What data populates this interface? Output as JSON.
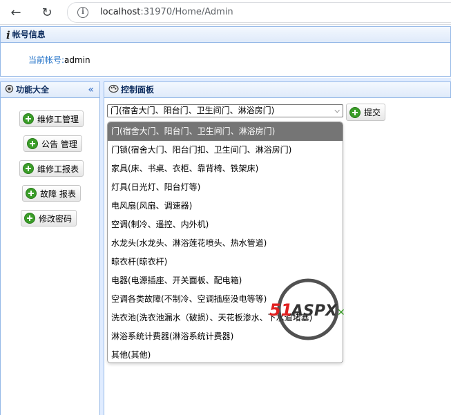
{
  "browser": {
    "url_host": "localhost",
    "url_rest": ":31970/Home/Admin"
  },
  "account": {
    "title": "帐号信息",
    "label": "当前帐号:",
    "value": "admin"
  },
  "left_panel": {
    "title": "功能大全",
    "collapse_icon": "«",
    "buttons": [
      "维修工管理",
      "公告 管理",
      "维修工报表",
      "故障 报表",
      "修改密码"
    ]
  },
  "right_panel": {
    "title": "控制面板",
    "select_value": "门(宿舍大门、阳台门、卫生间门、淋浴房门)",
    "submit_label": "提交",
    "options": [
      "门(宿舍大门、阳台门、卫生间门、淋浴房门)",
      "门锁(宿舍大门、阳台门扣、卫生间门、淋浴房门)",
      "家具(床、书桌、衣柜、靠背椅、铁架床)",
      "灯具(日光灯、阳台灯等)",
      "电风扇(风扇、调速器)",
      "空调(制冷、遥控、内外机)",
      "水龙头(水龙头、淋浴莲花喷头、热水管道)",
      "晾衣杆(晾衣杆)",
      "电器(电源插座、开关面板、配电箱)",
      "空调各类故障(不制冷、空调插座没电等等)",
      "洗衣池(洗衣池漏水（破损）、天花板渗水、下水道堵塞)",
      "淋浴系统计费器(淋浴系统计费器)",
      "其他(其他)"
    ]
  },
  "watermark": {
    "text": "51ASPX"
  }
}
